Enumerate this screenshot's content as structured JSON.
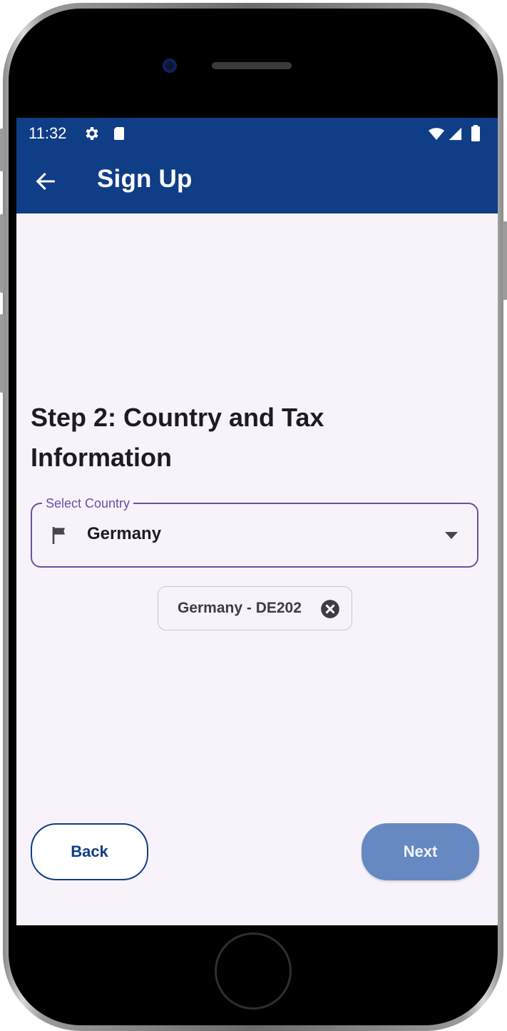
{
  "status_bar": {
    "time": "11:32",
    "icons": [
      "settings-icon",
      "sd-card-icon",
      "wifi-icon",
      "signal-icon",
      "battery-icon"
    ]
  },
  "app_bar": {
    "title": "Sign Up",
    "back_icon": "arrow-back-icon"
  },
  "step": {
    "title": "Step 2: Country and Tax Information"
  },
  "country_select": {
    "label": "Select Country",
    "value": "Germany",
    "leading_icon": "flag-icon",
    "trailing_icon": "dropdown-arrow-icon"
  },
  "chip": {
    "label": "Germany - DE202",
    "remove_icon": "cancel-icon"
  },
  "buttons": {
    "back_label": "Back",
    "next_label": "Next"
  },
  "colors": {
    "primary": "#0f3d86",
    "field_outline": "#6750a4",
    "next_button": "#6689c1",
    "background": "#f8f3fb"
  }
}
